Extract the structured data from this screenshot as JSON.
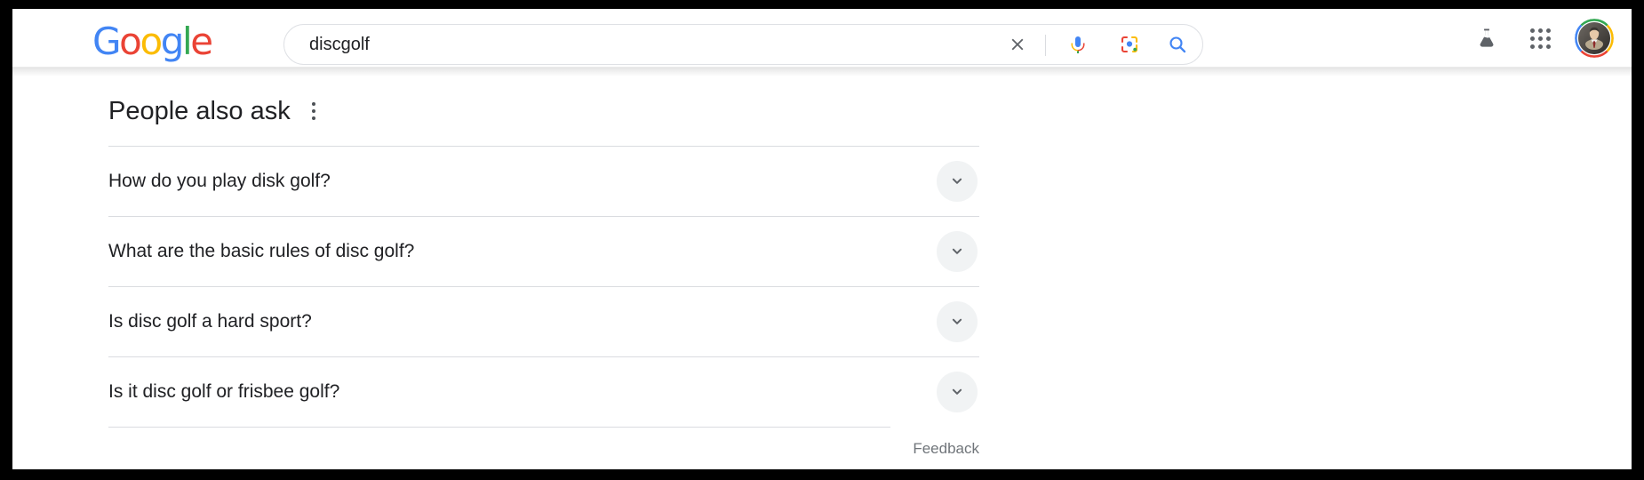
{
  "header": {
    "logo_text": "Google",
    "logo_colors": {
      "blue": "#4285F4",
      "red": "#EA4335",
      "yellow": "#FBBC05",
      "green": "#34A853"
    },
    "search": {
      "value": "discgolf",
      "placeholder": "Search",
      "clear_icon": "close-icon",
      "mic_icon": "microphone-icon",
      "lens_icon": "google-lens-icon",
      "search_icon": "search-icon"
    },
    "actions": {
      "labs_icon": "flask-icon",
      "apps_icon": "apps-grid-icon",
      "avatar_icon": "account-avatar"
    }
  },
  "main": {
    "paa": {
      "title": "People also ask",
      "menu_icon": "more-options-icon",
      "questions": [
        {
          "text": "How do you play disk golf?",
          "expand_icon": "chevron-down-icon"
        },
        {
          "text": "What are the basic rules of disc golf?",
          "expand_icon": "chevron-down-icon"
        },
        {
          "text": "Is disc golf a hard sport?",
          "expand_icon": "chevron-down-icon"
        },
        {
          "text": "Is it disc golf or frisbee golf?",
          "expand_icon": "chevron-down-icon"
        }
      ],
      "feedback_label": "Feedback"
    }
  }
}
